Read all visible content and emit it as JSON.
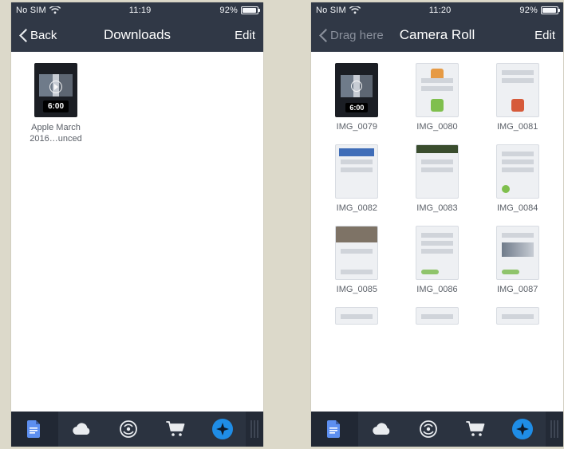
{
  "left": {
    "status": {
      "carrier": "No SIM",
      "time": "11:19",
      "battery_pct": "92%"
    },
    "nav": {
      "back_label": "Back",
      "title": "Downloads",
      "edit_label": "Edit"
    },
    "downloads": {
      "items": [
        {
          "label": "Apple March 2016…unced",
          "duration": "6:00"
        }
      ]
    }
  },
  "right": {
    "status": {
      "carrier": "No SIM",
      "time": "11:20",
      "battery_pct": "92%"
    },
    "nav": {
      "back_label": "Drag here",
      "title": "Camera Roll",
      "edit_label": "Edit"
    },
    "camera_roll": {
      "items": [
        {
          "label": "IMG_0079",
          "duration": "6:00",
          "kind": "video"
        },
        {
          "label": "IMG_0080",
          "kind": "app-orange-green"
        },
        {
          "label": "IMG_0081",
          "kind": "app-red"
        },
        {
          "label": "IMG_0082",
          "kind": "doc-blue"
        },
        {
          "label": "IMG_0083",
          "kind": "doc-greenhead"
        },
        {
          "label": "IMG_0084",
          "kind": "doc-lines"
        },
        {
          "label": "IMG_0085",
          "kind": "photo-list"
        },
        {
          "label": "IMG_0086",
          "kind": "doc-lines"
        },
        {
          "label": "IMG_0087",
          "kind": "doc-photo"
        }
      ]
    }
  },
  "colors": {
    "accent": "#1f8de6"
  }
}
